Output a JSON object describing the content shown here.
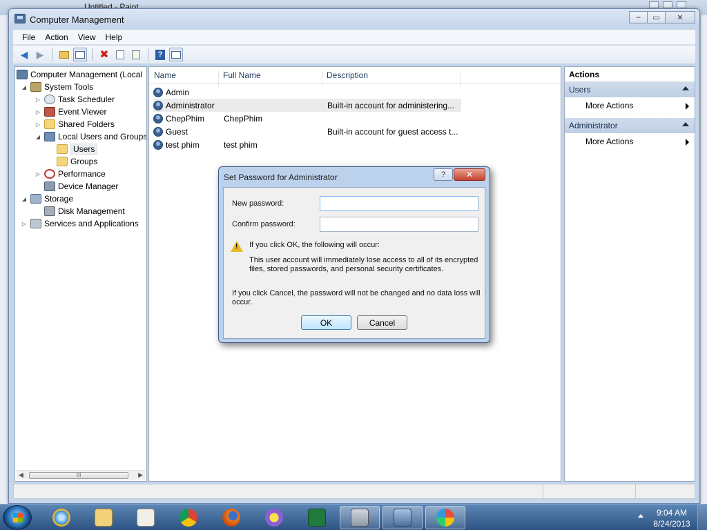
{
  "background_window": {
    "title": "Untitled - Paint"
  },
  "window": {
    "title": "Computer Management",
    "controls": {
      "minimize": "–",
      "restore": "▭",
      "close": "✕"
    }
  },
  "menu": [
    "File",
    "Action",
    "View",
    "Help"
  ],
  "toolbar": {
    "buttons": [
      "back-arrow-icon",
      "forward-arrow-icon",
      "up-folder-icon",
      "show-hide-tree-icon",
      "delete-icon",
      "properties-icon",
      "export-list-icon",
      "help-icon",
      "show-hide-action-pane-icon"
    ]
  },
  "tree": {
    "root": "Computer Management (Local",
    "system_tools": "System Tools",
    "task_scheduler": "Task Scheduler",
    "event_viewer": "Event Viewer",
    "shared_folders": "Shared Folders",
    "local_users": "Local Users and Groups",
    "users": "Users",
    "groups": "Groups",
    "performance": "Performance",
    "device_manager": "Device Manager",
    "storage": "Storage",
    "disk_management": "Disk Management",
    "services": "Services and Applications",
    "scroll_grip": "III"
  },
  "list": {
    "columns": {
      "name": "Name",
      "full_name": "Full Name",
      "description": "Description"
    },
    "rows": [
      {
        "name": "Admin",
        "full_name": "",
        "description": ""
      },
      {
        "name": "Administrator",
        "full_name": "",
        "description": "Built-in account for administering..."
      },
      {
        "name": "ChepPhim",
        "full_name": "ChepPhim",
        "description": ""
      },
      {
        "name": "Guest",
        "full_name": "",
        "description": "Built-in account for guest access t..."
      },
      {
        "name": "test phim",
        "full_name": "test phim",
        "description": ""
      }
    ]
  },
  "actions": {
    "title": "Actions",
    "sections": [
      {
        "header": "Users",
        "item": "More Actions"
      },
      {
        "header": "Administrator",
        "item": "More Actions"
      }
    ]
  },
  "dialog": {
    "title": "Set Password for Administrator",
    "help": "?",
    "close": "✕",
    "new_password_label": "New password:",
    "new_password_value": "",
    "confirm_password_label": "Confirm password:",
    "confirm_password_value": "",
    "warning_heading": "If you click OK, the following will occur:",
    "warning_line1": "This user account will immediately lose access to all of its encrypted",
    "warning_line2": "files, stored passwords, and personal security certificates.",
    "cancel_note_line1": "If you click Cancel, the password will not be changed and no data loss will",
    "cancel_note_line2": "occur.",
    "ok_label": "OK",
    "cancel_label": "Cancel"
  },
  "taskbar": {
    "apps": [
      "internet-explorer-icon",
      "file-explorer-icon",
      "media-player-icon",
      "chrome-icon",
      "firefox-icon",
      "messenger-icon",
      "excel-icon",
      "drive-tool-icon",
      "computer-management-icon",
      "paint-icon"
    ],
    "time": "9:04 AM",
    "date": "8/24/2013"
  },
  "colors": {
    "accent": "#3c7fb1",
    "dialog_frame": "#bcd1ec",
    "taskbar": "#2d5383",
    "action_header": "#c6d6ea"
  }
}
